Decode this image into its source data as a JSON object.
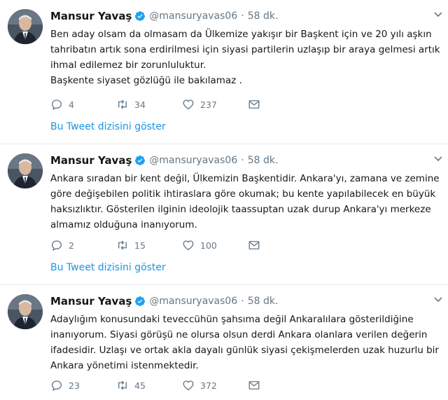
{
  "tweets": [
    {
      "name": "Mansur Yavaş",
      "handle": "@mansuryavas06",
      "separator": "·",
      "time": "58 dk.",
      "lines": [
        "Ben aday olsam da olmasam da Ülkemize yakışır bir Başkent için ve 20 yılı aşkın",
        "tahribatın artık sona erdirilmesi için siyasi partilerin uzlaşıp bir araya gelmesi artık",
        "ihmal edilemez bir zorunluluktur.",
        "Başkente siyaset gözlüğü ile bakılamaz ."
      ],
      "replies": "4",
      "retweets": "34",
      "likes": "237",
      "thread_link": "Bu Tweet dizisini göster"
    },
    {
      "name": "Mansur Yavaş",
      "handle": "@mansuryavas06",
      "separator": "·",
      "time": "58 dk.",
      "lines": [
        "Ankara sıradan bir kent değil, Ülkemizin Başkentidir. Ankara'yı, zamana ve zemine",
        "göre değişebilen politik ihtiraslara göre okumak; bu kente yapılabilecek en büyük",
        "haksızlıktır. Gösterilen ilginin ideolojik taassuptan uzak durup Ankara'yı merkeze",
        "almamız olduğuna inanıyorum."
      ],
      "replies": "2",
      "retweets": "15",
      "likes": "100",
      "thread_link": "Bu Tweet dizisini göster"
    },
    {
      "name": "Mansur Yavaş",
      "handle": "@mansuryavas06",
      "separator": "·",
      "time": "58 dk.",
      "lines": [
        "Adaylığım konusundaki teveccühün şahsıma değil Ankaralılara gösterildiğine",
        "inanıyorum. Siyasi görüşü ne olursa olsun derdi Ankara olanlara verilen değerin",
        "ifadesidir. Uzlaşı ve ortak akla dayalı günlük siyasi çekişmelerden uzak huzurlu bir",
        "Ankara yönetimi istenmektedir."
      ],
      "replies": "23",
      "retweets": "45",
      "likes": "372"
    }
  ],
  "colors": {
    "link": "#1b95e0",
    "verified": "#1da1f2",
    "muted": "#657786",
    "text": "#14171a",
    "divider": "#e6ecf0"
  },
  "icons": [
    "verified-badge-icon",
    "chevron-down-icon",
    "reply-icon",
    "retweet-icon",
    "like-icon",
    "direct-message-icon"
  ]
}
